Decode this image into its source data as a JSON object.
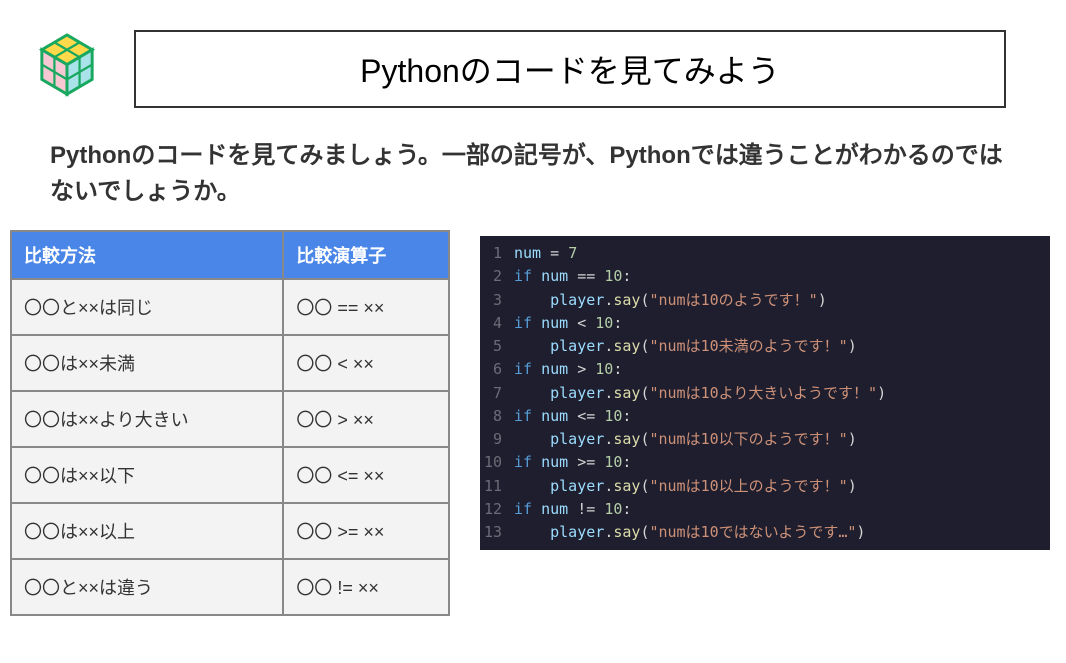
{
  "title": "Pythonのコードを見てみよう",
  "intro": "Pythonのコードを見てみましょう。一部の記号が、Pythonでは違うことがわかるのではないでしょうか。",
  "table": {
    "headers": {
      "method": "比較方法",
      "operator": "比較演算子"
    },
    "rows": [
      {
        "method": "〇〇と××は同じ",
        "operator": "〇〇 == ××"
      },
      {
        "method": "〇〇は××未満",
        "operator": "〇〇 < ××"
      },
      {
        "method": "〇〇は××より大きい",
        "operator": "〇〇 > ××"
      },
      {
        "method": "〇〇は××以下",
        "operator": "〇〇 <= ××"
      },
      {
        "method": "〇〇は××以上",
        "operator": "〇〇 >= ××"
      },
      {
        "method": "〇〇と××は違う",
        "operator": "〇〇 != ××"
      }
    ]
  },
  "code": {
    "lines": [
      [
        {
          "t": "var",
          "v": "num"
        },
        {
          "t": "op",
          "v": " = "
        },
        {
          "t": "num",
          "v": "7"
        }
      ],
      [
        {
          "t": "kw",
          "v": "if"
        },
        {
          "t": "op",
          "v": " "
        },
        {
          "t": "var",
          "v": "num"
        },
        {
          "t": "op",
          "v": " == "
        },
        {
          "t": "num",
          "v": "10"
        },
        {
          "t": "punct",
          "v": ":"
        }
      ],
      [
        {
          "t": "op",
          "v": "    "
        },
        {
          "t": "var",
          "v": "player"
        },
        {
          "t": "punct",
          "v": "."
        },
        {
          "t": "func",
          "v": "say"
        },
        {
          "t": "punct",
          "v": "("
        },
        {
          "t": "str",
          "v": "\"numは10のようです！\""
        },
        {
          "t": "punct",
          "v": ")"
        }
      ],
      [
        {
          "t": "kw",
          "v": "if"
        },
        {
          "t": "op",
          "v": " "
        },
        {
          "t": "var",
          "v": "num"
        },
        {
          "t": "op",
          "v": " < "
        },
        {
          "t": "num",
          "v": "10"
        },
        {
          "t": "punct",
          "v": ":"
        }
      ],
      [
        {
          "t": "op",
          "v": "    "
        },
        {
          "t": "var",
          "v": "player"
        },
        {
          "t": "punct",
          "v": "."
        },
        {
          "t": "func",
          "v": "say"
        },
        {
          "t": "punct",
          "v": "("
        },
        {
          "t": "str",
          "v": "\"numは10未満のようです！\""
        },
        {
          "t": "punct",
          "v": ")"
        }
      ],
      [
        {
          "t": "kw",
          "v": "if"
        },
        {
          "t": "op",
          "v": " "
        },
        {
          "t": "var",
          "v": "num"
        },
        {
          "t": "op",
          "v": " > "
        },
        {
          "t": "num",
          "v": "10"
        },
        {
          "t": "punct",
          "v": ":"
        }
      ],
      [
        {
          "t": "op",
          "v": "    "
        },
        {
          "t": "var",
          "v": "player"
        },
        {
          "t": "punct",
          "v": "."
        },
        {
          "t": "func",
          "v": "say"
        },
        {
          "t": "punct",
          "v": "("
        },
        {
          "t": "str",
          "v": "\"numは10より大きいようです！\""
        },
        {
          "t": "punct",
          "v": ")"
        }
      ],
      [
        {
          "t": "kw",
          "v": "if"
        },
        {
          "t": "op",
          "v": " "
        },
        {
          "t": "var",
          "v": "num"
        },
        {
          "t": "op",
          "v": " <= "
        },
        {
          "t": "num",
          "v": "10"
        },
        {
          "t": "punct",
          "v": ":"
        }
      ],
      [
        {
          "t": "op",
          "v": "    "
        },
        {
          "t": "var",
          "v": "player"
        },
        {
          "t": "punct",
          "v": "."
        },
        {
          "t": "func",
          "v": "say"
        },
        {
          "t": "punct",
          "v": "("
        },
        {
          "t": "str",
          "v": "\"numは10以下のようです！\""
        },
        {
          "t": "punct",
          "v": ")"
        }
      ],
      [
        {
          "t": "kw",
          "v": "if"
        },
        {
          "t": "op",
          "v": " "
        },
        {
          "t": "var",
          "v": "num"
        },
        {
          "t": "op",
          "v": " >= "
        },
        {
          "t": "num",
          "v": "10"
        },
        {
          "t": "punct",
          "v": ":"
        }
      ],
      [
        {
          "t": "op",
          "v": "    "
        },
        {
          "t": "var",
          "v": "player"
        },
        {
          "t": "punct",
          "v": "."
        },
        {
          "t": "func",
          "v": "say"
        },
        {
          "t": "punct",
          "v": "("
        },
        {
          "t": "str",
          "v": "\"numは10以上のようです！\""
        },
        {
          "t": "punct",
          "v": ")"
        }
      ],
      [
        {
          "t": "kw",
          "v": "if"
        },
        {
          "t": "op",
          "v": " "
        },
        {
          "t": "var",
          "v": "num"
        },
        {
          "t": "op",
          "v": " != "
        },
        {
          "t": "num",
          "v": "10"
        },
        {
          "t": "punct",
          "v": ":"
        }
      ],
      [
        {
          "t": "op",
          "v": "    "
        },
        {
          "t": "var",
          "v": "player"
        },
        {
          "t": "punct",
          "v": "."
        },
        {
          "t": "func",
          "v": "say"
        },
        {
          "t": "punct",
          "v": "("
        },
        {
          "t": "str",
          "v": "\"numは10ではないようです…\""
        },
        {
          "t": "punct",
          "v": ")"
        }
      ]
    ]
  }
}
